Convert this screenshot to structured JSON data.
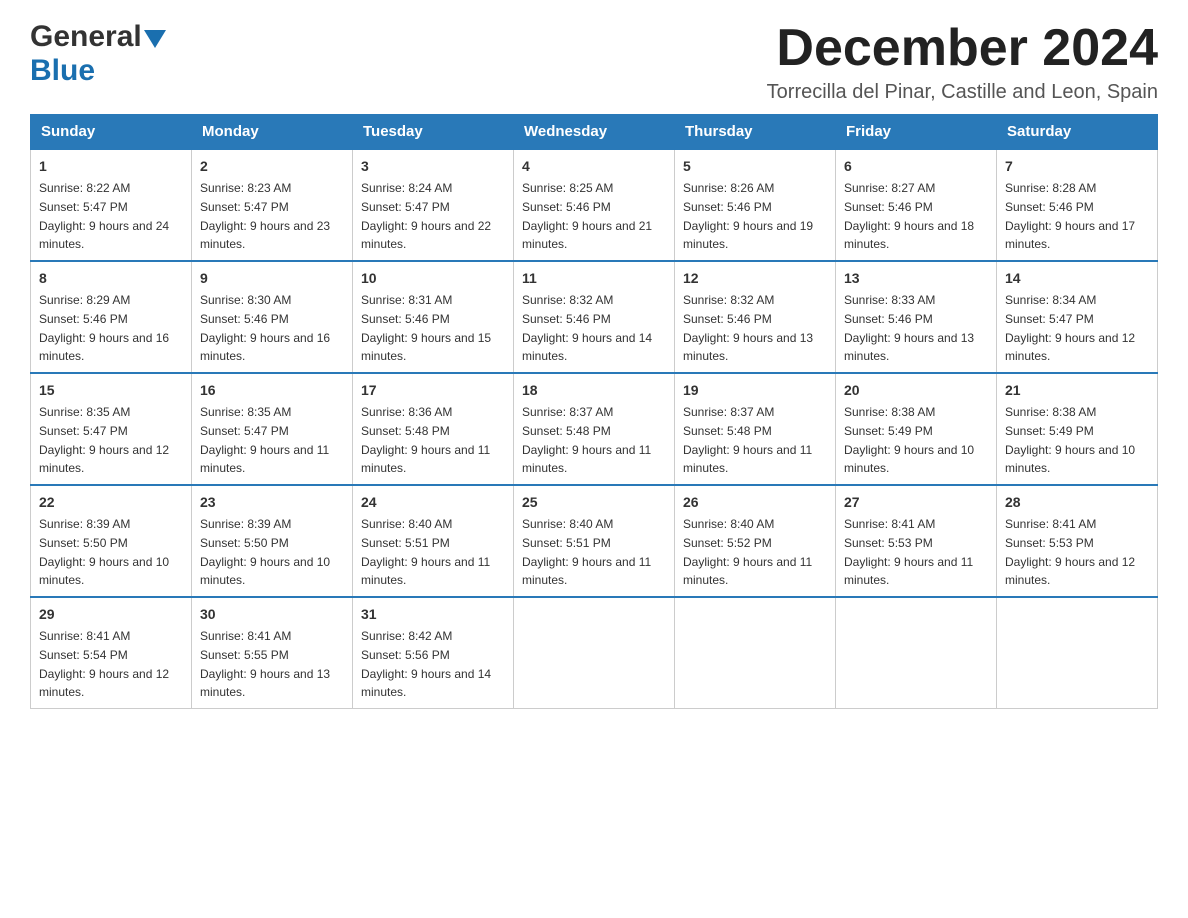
{
  "logo": {
    "general": "General",
    "blue": "Blue",
    "line2_blue": "Blue"
  },
  "title": "December 2024",
  "subtitle": "Torrecilla del Pinar, Castille and Leon, Spain",
  "days_of_week": [
    "Sunday",
    "Monday",
    "Tuesday",
    "Wednesday",
    "Thursday",
    "Friday",
    "Saturday"
  ],
  "weeks": [
    [
      {
        "day": "1",
        "sunrise": "Sunrise: 8:22 AM",
        "sunset": "Sunset: 5:47 PM",
        "daylight": "Daylight: 9 hours and 24 minutes."
      },
      {
        "day": "2",
        "sunrise": "Sunrise: 8:23 AM",
        "sunset": "Sunset: 5:47 PM",
        "daylight": "Daylight: 9 hours and 23 minutes."
      },
      {
        "day": "3",
        "sunrise": "Sunrise: 8:24 AM",
        "sunset": "Sunset: 5:47 PM",
        "daylight": "Daylight: 9 hours and 22 minutes."
      },
      {
        "day": "4",
        "sunrise": "Sunrise: 8:25 AM",
        "sunset": "Sunset: 5:46 PM",
        "daylight": "Daylight: 9 hours and 21 minutes."
      },
      {
        "day": "5",
        "sunrise": "Sunrise: 8:26 AM",
        "sunset": "Sunset: 5:46 PM",
        "daylight": "Daylight: 9 hours and 19 minutes."
      },
      {
        "day": "6",
        "sunrise": "Sunrise: 8:27 AM",
        "sunset": "Sunset: 5:46 PM",
        "daylight": "Daylight: 9 hours and 18 minutes."
      },
      {
        "day": "7",
        "sunrise": "Sunrise: 8:28 AM",
        "sunset": "Sunset: 5:46 PM",
        "daylight": "Daylight: 9 hours and 17 minutes."
      }
    ],
    [
      {
        "day": "8",
        "sunrise": "Sunrise: 8:29 AM",
        "sunset": "Sunset: 5:46 PM",
        "daylight": "Daylight: 9 hours and 16 minutes."
      },
      {
        "day": "9",
        "sunrise": "Sunrise: 8:30 AM",
        "sunset": "Sunset: 5:46 PM",
        "daylight": "Daylight: 9 hours and 16 minutes."
      },
      {
        "day": "10",
        "sunrise": "Sunrise: 8:31 AM",
        "sunset": "Sunset: 5:46 PM",
        "daylight": "Daylight: 9 hours and 15 minutes."
      },
      {
        "day": "11",
        "sunrise": "Sunrise: 8:32 AM",
        "sunset": "Sunset: 5:46 PM",
        "daylight": "Daylight: 9 hours and 14 minutes."
      },
      {
        "day": "12",
        "sunrise": "Sunrise: 8:32 AM",
        "sunset": "Sunset: 5:46 PM",
        "daylight": "Daylight: 9 hours and 13 minutes."
      },
      {
        "day": "13",
        "sunrise": "Sunrise: 8:33 AM",
        "sunset": "Sunset: 5:46 PM",
        "daylight": "Daylight: 9 hours and 13 minutes."
      },
      {
        "day": "14",
        "sunrise": "Sunrise: 8:34 AM",
        "sunset": "Sunset: 5:47 PM",
        "daylight": "Daylight: 9 hours and 12 minutes."
      }
    ],
    [
      {
        "day": "15",
        "sunrise": "Sunrise: 8:35 AM",
        "sunset": "Sunset: 5:47 PM",
        "daylight": "Daylight: 9 hours and 12 minutes."
      },
      {
        "day": "16",
        "sunrise": "Sunrise: 8:35 AM",
        "sunset": "Sunset: 5:47 PM",
        "daylight": "Daylight: 9 hours and 11 minutes."
      },
      {
        "day": "17",
        "sunrise": "Sunrise: 8:36 AM",
        "sunset": "Sunset: 5:48 PM",
        "daylight": "Daylight: 9 hours and 11 minutes."
      },
      {
        "day": "18",
        "sunrise": "Sunrise: 8:37 AM",
        "sunset": "Sunset: 5:48 PM",
        "daylight": "Daylight: 9 hours and 11 minutes."
      },
      {
        "day": "19",
        "sunrise": "Sunrise: 8:37 AM",
        "sunset": "Sunset: 5:48 PM",
        "daylight": "Daylight: 9 hours and 11 minutes."
      },
      {
        "day": "20",
        "sunrise": "Sunrise: 8:38 AM",
        "sunset": "Sunset: 5:49 PM",
        "daylight": "Daylight: 9 hours and 10 minutes."
      },
      {
        "day": "21",
        "sunrise": "Sunrise: 8:38 AM",
        "sunset": "Sunset: 5:49 PM",
        "daylight": "Daylight: 9 hours and 10 minutes."
      }
    ],
    [
      {
        "day": "22",
        "sunrise": "Sunrise: 8:39 AM",
        "sunset": "Sunset: 5:50 PM",
        "daylight": "Daylight: 9 hours and 10 minutes."
      },
      {
        "day": "23",
        "sunrise": "Sunrise: 8:39 AM",
        "sunset": "Sunset: 5:50 PM",
        "daylight": "Daylight: 9 hours and 10 minutes."
      },
      {
        "day": "24",
        "sunrise": "Sunrise: 8:40 AM",
        "sunset": "Sunset: 5:51 PM",
        "daylight": "Daylight: 9 hours and 11 minutes."
      },
      {
        "day": "25",
        "sunrise": "Sunrise: 8:40 AM",
        "sunset": "Sunset: 5:51 PM",
        "daylight": "Daylight: 9 hours and 11 minutes."
      },
      {
        "day": "26",
        "sunrise": "Sunrise: 8:40 AM",
        "sunset": "Sunset: 5:52 PM",
        "daylight": "Daylight: 9 hours and 11 minutes."
      },
      {
        "day": "27",
        "sunrise": "Sunrise: 8:41 AM",
        "sunset": "Sunset: 5:53 PM",
        "daylight": "Daylight: 9 hours and 11 minutes."
      },
      {
        "day": "28",
        "sunrise": "Sunrise: 8:41 AM",
        "sunset": "Sunset: 5:53 PM",
        "daylight": "Daylight: 9 hours and 12 minutes."
      }
    ],
    [
      {
        "day": "29",
        "sunrise": "Sunrise: 8:41 AM",
        "sunset": "Sunset: 5:54 PM",
        "daylight": "Daylight: 9 hours and 12 minutes."
      },
      {
        "day": "30",
        "sunrise": "Sunrise: 8:41 AM",
        "sunset": "Sunset: 5:55 PM",
        "daylight": "Daylight: 9 hours and 13 minutes."
      },
      {
        "day": "31",
        "sunrise": "Sunrise: 8:42 AM",
        "sunset": "Sunset: 5:56 PM",
        "daylight": "Daylight: 9 hours and 14 minutes."
      },
      null,
      null,
      null,
      null
    ]
  ]
}
